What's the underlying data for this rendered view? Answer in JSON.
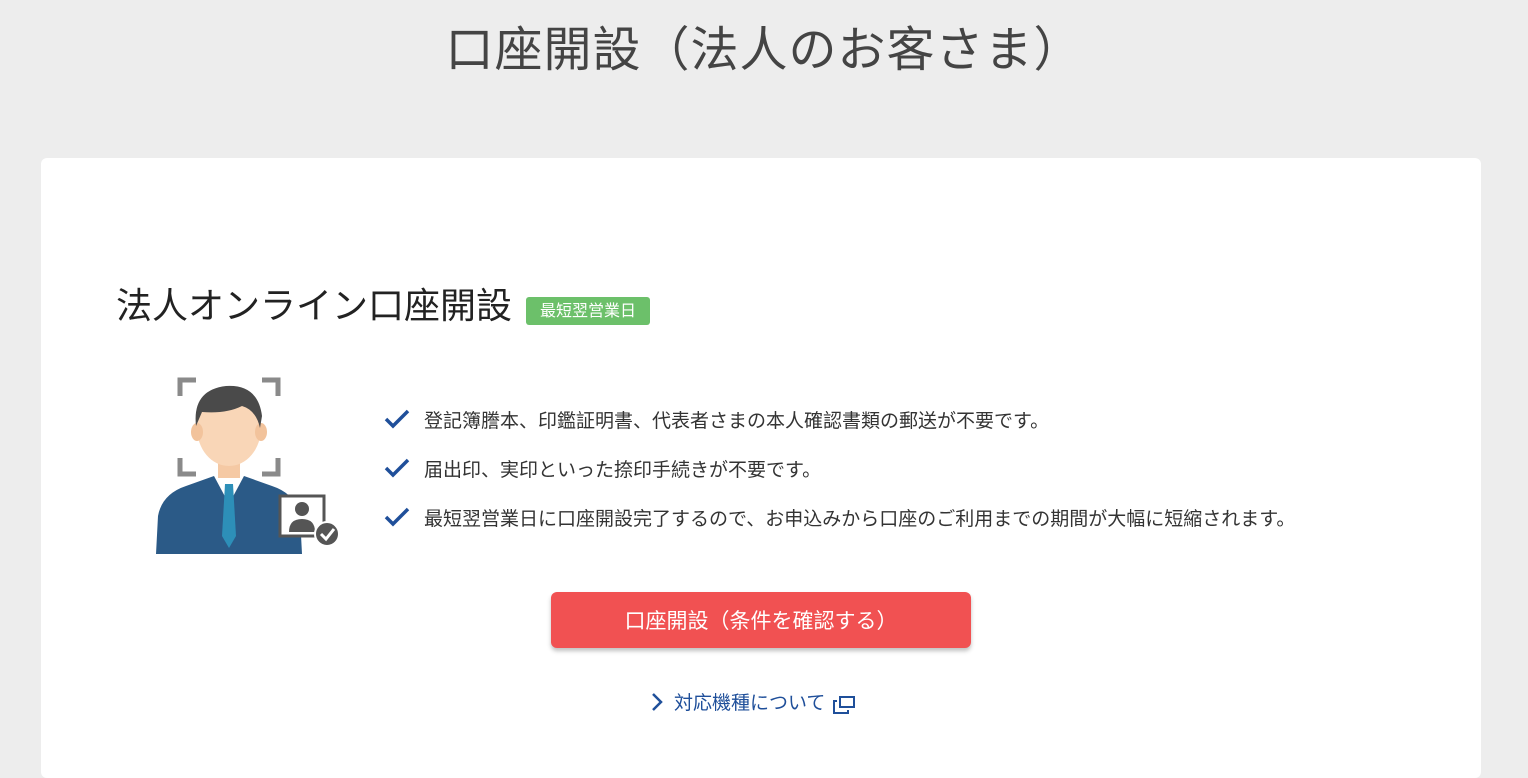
{
  "page": {
    "title": "口座開設（法人のお客さま）"
  },
  "section": {
    "title": "法人オンライン口座開設",
    "badge": "最短翌営業日"
  },
  "features": [
    "登記簿謄本、印鑑証明書、代表者さまの本人確認書類の郵送が不要です。",
    "届出印、実印といった捺印手続きが不要です。",
    "最短翌営業日に口座開設完了するので、お申込みから口座のご利用までの期間が大幅に短縮されます。"
  ],
  "cta": {
    "label": "口座開設（条件を確認する）"
  },
  "link": {
    "label": "対応機種について"
  },
  "colors": {
    "background": "#ededed",
    "card": "#ffffff",
    "badge": "#6cc06a",
    "button": "#f15152",
    "check": "#1f4f9a",
    "link": "#1f4f9a"
  },
  "icons": {
    "illustration": "businessman-id-verification-icon",
    "check": "check-icon",
    "chevron": "chevron-right-icon",
    "external": "external-window-icon"
  }
}
